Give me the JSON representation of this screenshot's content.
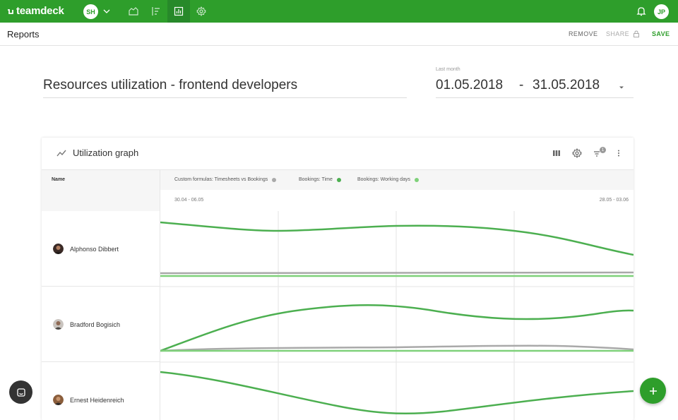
{
  "topbar": {
    "logo": "teamdeck",
    "workspace_initials": "SH",
    "user_initials": "JP",
    "nav": [
      "projects-icon",
      "timeline-icon",
      "reports-icon",
      "settings-icon"
    ],
    "active_nav": "reports-icon",
    "brand_color": "#2e9e2b"
  },
  "subheader": {
    "title": "Reports",
    "remove_label": "REMOVE",
    "share_label": "SHARE",
    "save_label": "SAVE"
  },
  "report": {
    "title": "Resources utilization - frontend developers",
    "range_label": "Last month",
    "date_start": "01.05.2018",
    "date_separator": "-",
    "date_end": "31.05.2018"
  },
  "card": {
    "title": "Utilization graph",
    "filter_count": "1",
    "name_header": "Name",
    "legend": [
      {
        "label": "Custom formulas: Timesheets vs Bookings",
        "color": "#a9a9a9"
      },
      {
        "label": "Bookings: Time",
        "color": "#4caf50"
      },
      {
        "label": "Bookings: Working days",
        "color": "#7fd17a"
      }
    ],
    "axis_start": "30.04 - 06.05",
    "axis_end": "28.05 - 03.06",
    "people": [
      {
        "name": "Alphonso Dibbert"
      },
      {
        "name": "Bradford Bogisich"
      },
      {
        "name": "Ernest Heidenreich"
      }
    ]
  }
}
